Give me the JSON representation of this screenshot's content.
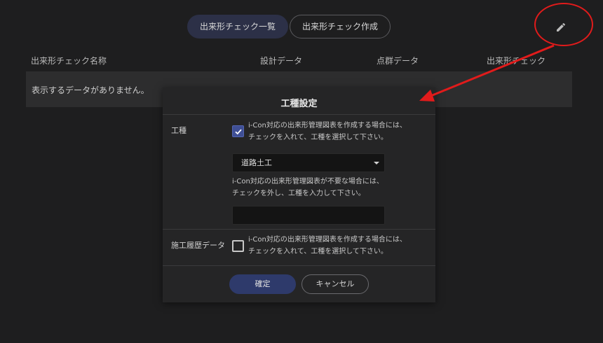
{
  "tabs": [
    {
      "label": "出来形チェック一覧",
      "active": true
    },
    {
      "label": "出来形チェック作成",
      "active": false
    }
  ],
  "toolbar": {
    "edit_icon": "pencil-icon"
  },
  "table": {
    "columns": [
      "出来形チェック名称",
      "設計データ",
      "点群データ",
      "出来形チェック"
    ],
    "empty_message": "表示するデータがありません。"
  },
  "dialog": {
    "title": "工種設定",
    "koshu": {
      "label": "工種",
      "checked": true,
      "help_checked": [
        "i-Con対応の出来形管理図表を作成する場合には、",
        "チェックを入れて、工種を選択して下さい。"
      ],
      "select_value": "道路土工",
      "help_unchecked": [
        "i-Con対応の出来形管理図表が不要な場合には、",
        "チェックを外し、工種を入力して下さい。"
      ],
      "input_value": ""
    },
    "history": {
      "label": "施工履歴データ",
      "checked": false,
      "help": [
        "i-Con対応の出来形管理図表を作成する場合には、",
        "チェックを入れて、工種を選択して下さい。"
      ]
    },
    "confirm_label": "確定",
    "cancel_label": "キャンセル"
  },
  "colors": {
    "background": "#1e1e1f",
    "dialog": "#252526",
    "accent": "#3f4f95",
    "annotation": "#e11b1b"
  }
}
